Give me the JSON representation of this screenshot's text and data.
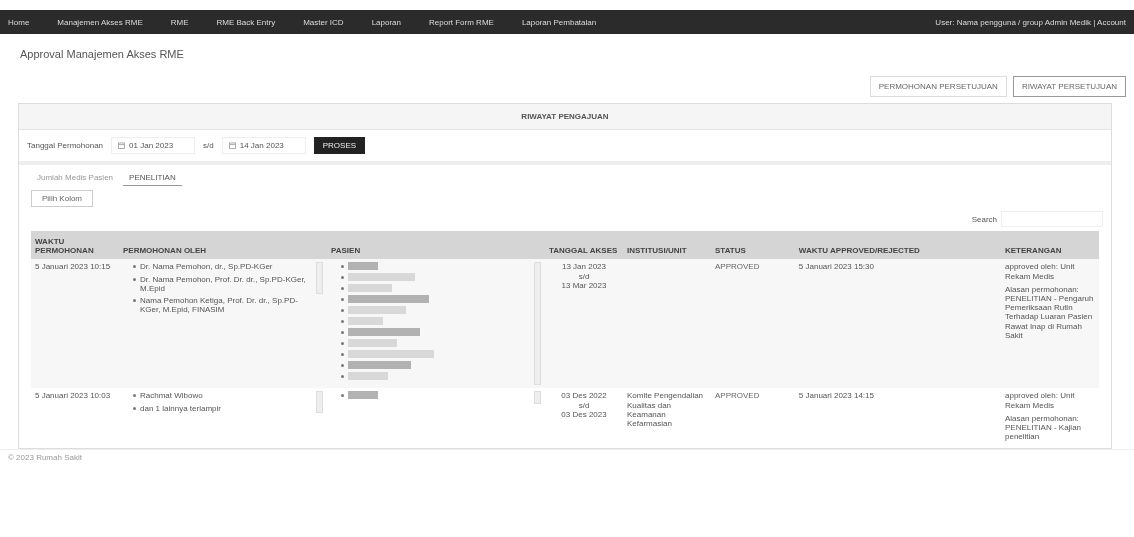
{
  "navbar": {
    "items": [
      "Home",
      "Manajemen Akses RME",
      "RME",
      "RME Back Entry",
      "Master ICD",
      "Laporan",
      "Report Form RME",
      "Laporan Pembatalan"
    ],
    "user": "User: Nama pengguna / group Admin Medik | Account"
  },
  "page_title": "Approval Manajemen Akses RME",
  "top_buttons": [
    {
      "label": "PERMOHONAN PERSETUJUAN",
      "selected": false
    },
    {
      "label": "RIWAYAT PERSETUJUAN",
      "selected": true
    }
  ],
  "panel_title": "RIWAYAT PENGAJUAN",
  "filter": {
    "label": "Tanggal Permohonan",
    "date_from": "01 Jan 2023",
    "separator": "s/d",
    "date_to": "14 Jan 2023",
    "button": "PROSES"
  },
  "tabs": [
    {
      "label": "Jumlah Medis Pasien",
      "selected": false
    },
    {
      "label": "PENELITIAN",
      "selected": true
    }
  ],
  "column_button": "Pilih Kolom",
  "search": {
    "label": "Search"
  },
  "table": {
    "columns": [
      "WAKTU PERMOHONAN",
      "PERMOHONAN OLEH",
      "PASIEN",
      "TANGGAL AKSES",
      "INSTITUSI/UNIT",
      "STATUS",
      "WAKTU APPROVED/REJECTED",
      "KETERANGAN"
    ],
    "rows": [
      {
        "time": "5 Januari 2023 10:15",
        "requesters": [
          "Dr. Nama Pemohon, dr., Sp.PD-KGer",
          "Dr. Nama Pemohon, Prof. Dr. dr., Sp.PD-KGer, M.Epid",
          "Nama Pemohon Ketiga, Prof. Dr. dr., Sp.PD-KGer, M.Epid, FINASIM"
        ],
        "access": [
          "13 Jan 2023",
          "s/d",
          "13 Mar 2023"
        ],
        "unit": "",
        "status": "APPROVED",
        "approved_time": "5 Januari 2023 15:30",
        "notes": [
          "approved oleh: Unit Rekam Medis",
          "Alasan permohonan: PENELITIAN - Pengaruh Pemeriksaan Rutin Terhadap Luaran Pasien Rawat Inap di Rumah Sakit"
        ]
      },
      {
        "time": "5 Januari 2023 10:03",
        "requesters": [
          "Rachmat Wibowo",
          "dan 1 lainnya terlampir"
        ],
        "access": [
          "03 Des 2022",
          "s/d",
          "03 Des 2023"
        ],
        "unit": "Komite Pengendalian Kualitas dan Keamanan Kefarmasian",
        "status": "APPROVED",
        "approved_time": "5 Januari 2023 14:15",
        "notes": [
          "approved oleh: Unit Rekam Medis",
          "Alasan permohonan: PENELITIAN - Kajian penelitian"
        ]
      }
    ]
  },
  "footer": "© 2023 Rumah Sakit"
}
